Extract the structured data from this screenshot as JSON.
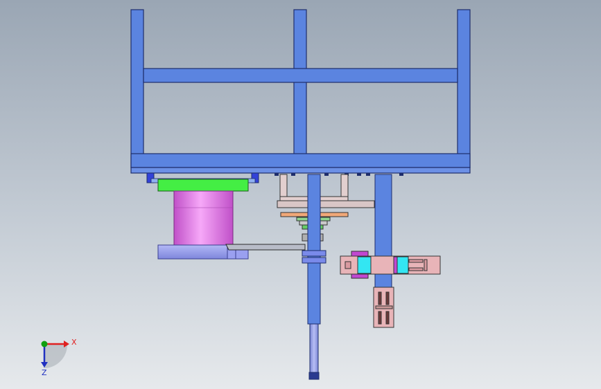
{
  "viewport": {
    "background_top": "#9aa6b4",
    "background_bottom": "#e6e9ec"
  },
  "colors": {
    "frame_blue": "#5b84e0",
    "frame_edge": "#1e2d6b",
    "green_plate": "#44ee44",
    "magenta_cylinder": "#e07ae6",
    "lavender_base": "#9aa0f0",
    "pink_block": "#e8b4b8",
    "cyan_block": "#33e6f2",
    "purple_block": "#c048d0",
    "axis_x": "#e02020",
    "axis_y": "#10a010",
    "axis_z": "#2030c0"
  },
  "triad": {
    "x_label": "X",
    "z_label": "Z"
  }
}
